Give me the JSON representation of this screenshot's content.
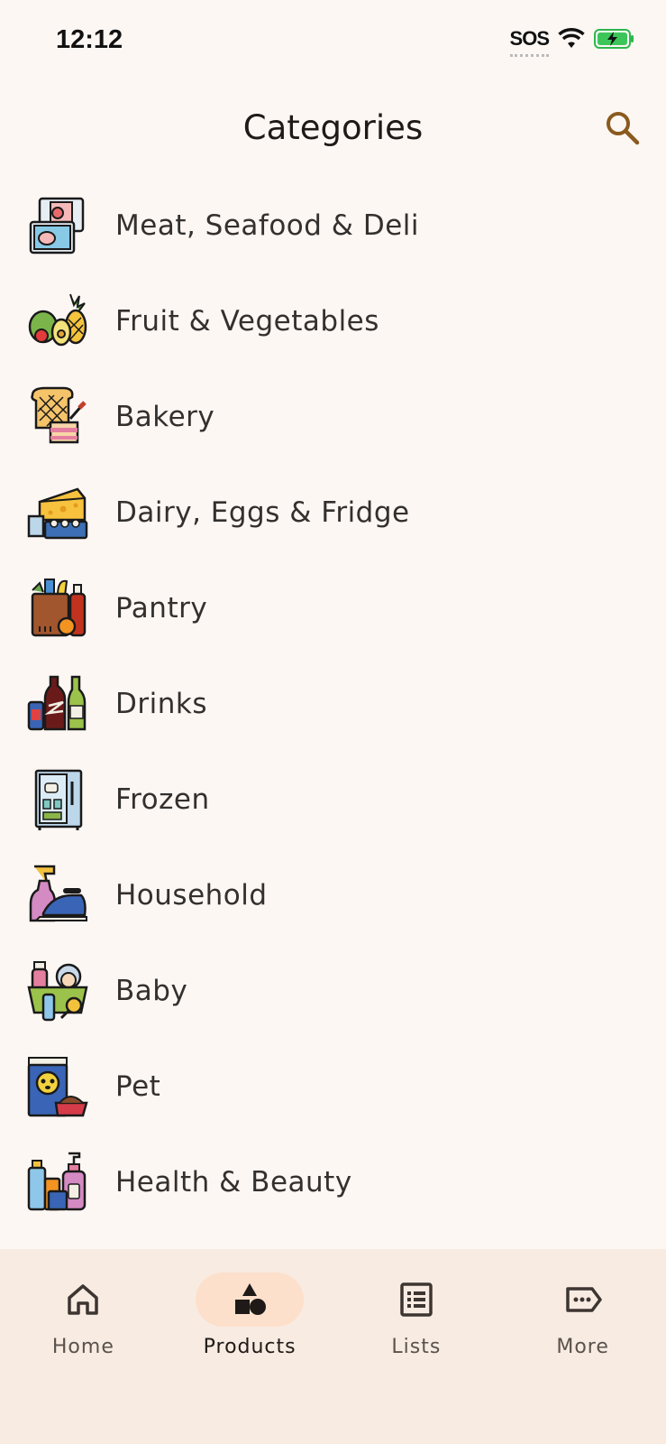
{
  "status": {
    "time": "12:12",
    "sos": "SOS"
  },
  "header": {
    "title": "Categories"
  },
  "categories": [
    {
      "label": "Meat, Seafood & Deli",
      "icon": "meat-icon"
    },
    {
      "label": "Fruit & Vegetables",
      "icon": "fruit-icon"
    },
    {
      "label": "Bakery",
      "icon": "bakery-icon"
    },
    {
      "label": "Dairy, Eggs & Fridge",
      "icon": "dairy-icon"
    },
    {
      "label": "Pantry",
      "icon": "pantry-icon"
    },
    {
      "label": "Drinks",
      "icon": "drinks-icon"
    },
    {
      "label": "Frozen",
      "icon": "frozen-icon"
    },
    {
      "label": "Household",
      "icon": "household-icon"
    },
    {
      "label": "Baby",
      "icon": "baby-icon"
    },
    {
      "label": "Pet",
      "icon": "pet-icon"
    },
    {
      "label": "Health & Beauty",
      "icon": "health-beauty-icon"
    }
  ],
  "nav": {
    "items": [
      {
        "label": "Home",
        "icon": "home-icon",
        "active": false
      },
      {
        "label": "Products",
        "icon": "shapes-icon",
        "active": true
      },
      {
        "label": "Lists",
        "icon": "list-icon",
        "active": false
      },
      {
        "label": "More",
        "icon": "tag-more-icon",
        "active": false
      }
    ]
  },
  "colors": {
    "background": "#fdf7f4",
    "nav_background": "#f8ebe2",
    "active_pill": "#fde0cb",
    "accent": "#8a5a1e"
  }
}
